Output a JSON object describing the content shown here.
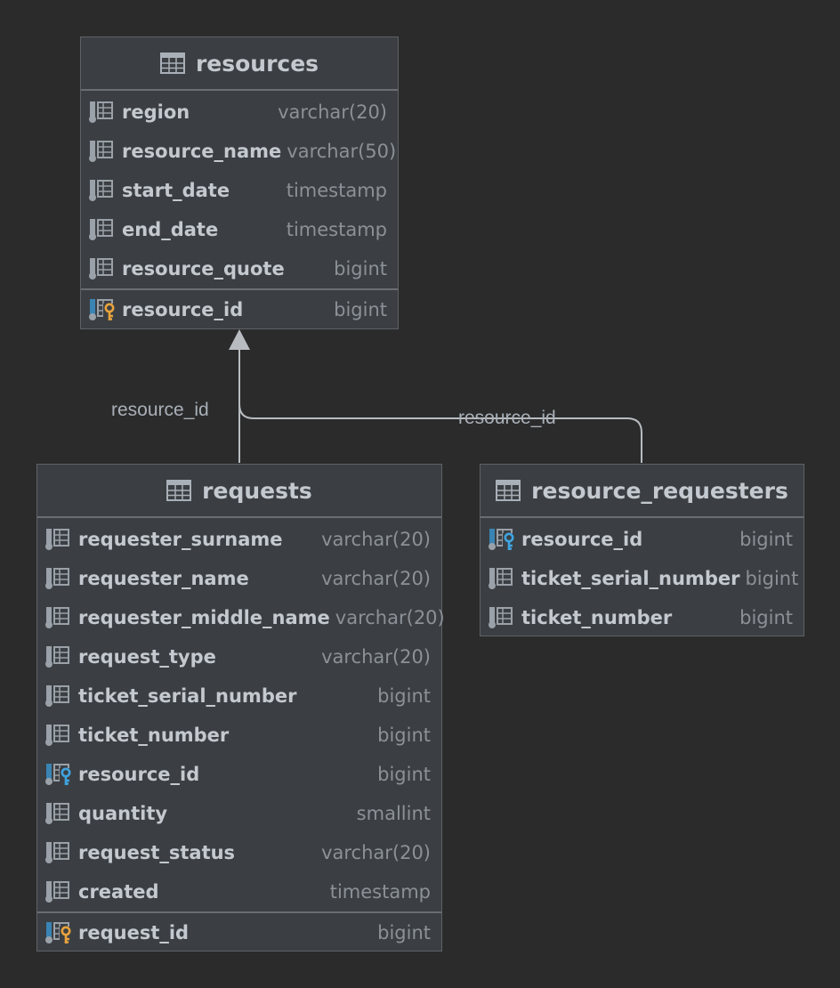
{
  "colors": {
    "background": "#2b2b2b",
    "table_bg": "#3b3f43",
    "column_marker": "#3a84b4",
    "pk_key": "#e8a33d",
    "fk_key": "#3fa4e0",
    "edge": "#b8bcc0"
  },
  "tables": {
    "resources": {
      "title": "resources",
      "columns": [
        {
          "name": "region",
          "type": "varchar(20)",
          "icon": "column-icon"
        },
        {
          "name": "resource_name",
          "type": "varchar(50)",
          "icon": "column-icon"
        },
        {
          "name": "start_date",
          "type": "timestamp",
          "icon": "column-icon"
        },
        {
          "name": "end_date",
          "type": "timestamp",
          "icon": "column-icon"
        },
        {
          "name": "resource_quote",
          "type": "bigint",
          "icon": "column-icon"
        }
      ],
      "pk": {
        "name": "resource_id",
        "type": "bigint",
        "icon": "primary-key-icon"
      }
    },
    "requests": {
      "title": "requests",
      "columns": [
        {
          "name": "requester_surname",
          "type": "varchar(20)",
          "icon": "column-icon"
        },
        {
          "name": "requester_name",
          "type": "varchar(20)",
          "icon": "column-icon"
        },
        {
          "name": "requester_middle_name",
          "type": "varchar(20)",
          "icon": "column-icon"
        },
        {
          "name": "request_type",
          "type": "varchar(20)",
          "icon": "column-icon"
        },
        {
          "name": "ticket_serial_number",
          "type": "bigint",
          "icon": "column-icon"
        },
        {
          "name": "ticket_number",
          "type": "bigint",
          "icon": "column-icon"
        },
        {
          "name": "resource_id",
          "type": "bigint",
          "icon": "foreign-key-icon"
        },
        {
          "name": "quantity",
          "type": "smallint",
          "icon": "column-icon"
        },
        {
          "name": "request_status",
          "type": "varchar(20)",
          "icon": "column-icon"
        },
        {
          "name": "created",
          "type": "timestamp",
          "icon": "column-icon"
        }
      ],
      "pk": {
        "name": "request_id",
        "type": "bigint",
        "icon": "primary-key-icon"
      }
    },
    "resource_requesters": {
      "title": "resource_requesters",
      "columns": [
        {
          "name": "resource_id",
          "type": "bigint",
          "icon": "foreign-key-icon"
        },
        {
          "name": "ticket_serial_number",
          "type": "bigint",
          "icon": "column-icon"
        },
        {
          "name": "ticket_number",
          "type": "bigint",
          "icon": "column-icon"
        }
      ]
    }
  },
  "relations": [
    {
      "label": "resource_id",
      "from": "requests",
      "to": "resources"
    },
    {
      "label": "resource_id",
      "from": "resource_requesters",
      "to": "resources"
    }
  ]
}
